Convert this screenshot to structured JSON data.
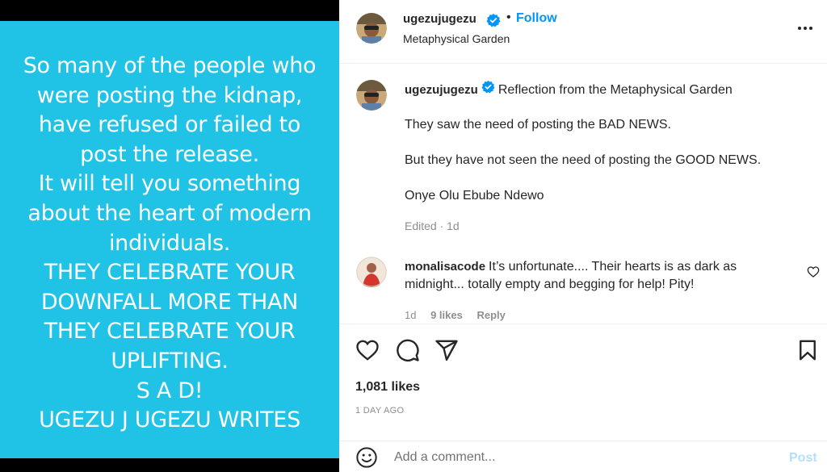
{
  "post": {
    "image_text_lines": [
      "So many of the people who",
      "were posting the kidnap,",
      "have refused or failed to",
      "post the release.",
      "It will tell you something",
      "about the heart of modern",
      "individuals.",
      "THEY CELEBRATE YOUR",
      "DOWNFALL MORE THAN",
      "THEY CELEBRATE YOUR",
      "UPLIFTING.",
      "S A D!",
      "UGEZU J UGEZU WRITES"
    ],
    "image_background_color": "#20c3e6"
  },
  "header": {
    "username": "ugezujugezu",
    "dot": "•",
    "follow_label": "Follow",
    "location": "Metaphysical Garden",
    "more_icon": "more-options-icon"
  },
  "caption": {
    "username": "ugezujugezu",
    "first_line": "Reflection from the Metaphysical Garden",
    "paragraphs": [
      "They saw the need of posting the BAD NEWS.",
      "But they have not seen the need of posting the GOOD NEWS.",
      "Onye Olu Ebube Ndewo"
    ],
    "meta": "Edited · 1d"
  },
  "comment": {
    "username": "monalisacode",
    "text": "It’s unfortunate.... Their hearts is as dark as midnight... totally empty and begging for help! Pity!",
    "time": "1d",
    "likes": "9 likes",
    "reply_label": "Reply"
  },
  "actions": {
    "likes_count": "1,081 likes",
    "timestamp": "1 DAY AGO"
  },
  "add_comment": {
    "placeholder": "Add a comment...",
    "post_label": "Post"
  },
  "colors": {
    "accent": "#0095f6",
    "verified": "#0095f6",
    "post_disabled": "#b2dffc"
  }
}
